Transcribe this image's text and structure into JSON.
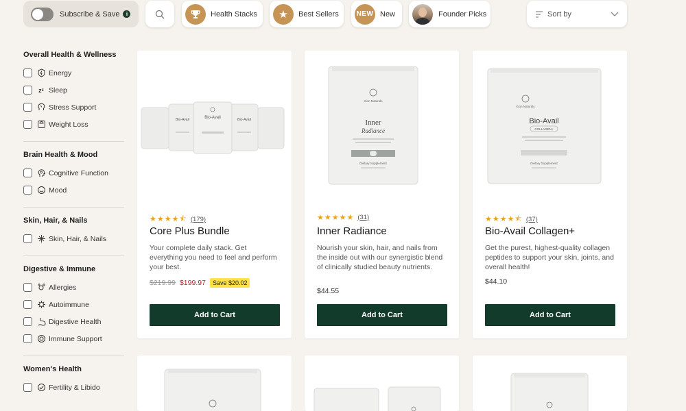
{
  "topbar": {
    "subscribe_label": "Subscribe & Save",
    "subscribe_info": "i",
    "chips": [
      {
        "label": "Health Stacks",
        "icon": "trophy-icon"
      },
      {
        "label": "Best Sellers",
        "icon": "star-icon"
      },
      {
        "label": "New",
        "icon": "new-badge-icon",
        "badge_text": "NEW"
      },
      {
        "label": "Founder Picks",
        "icon": "founder-avatar"
      }
    ],
    "sort_label": "Sort by"
  },
  "sidebar": {
    "groups": [
      {
        "title": "Overall Health & Wellness",
        "items": [
          "Energy",
          "Sleep",
          "Stress Support",
          "Weight Loss"
        ]
      },
      {
        "title": "Brain Health & Mood",
        "items": [
          "Cognitive Function",
          "Mood"
        ]
      },
      {
        "title": "Skin, Hair, & Nails",
        "items": [
          "Skin, Hair, & Nails"
        ]
      },
      {
        "title": "Digestive & Immune",
        "items": [
          "Allergies",
          "Autoimmune",
          "Digestive Health",
          "Immune Support"
        ]
      },
      {
        "title": "Women's Health",
        "items": [
          "Fertility & Libido"
        ]
      }
    ]
  },
  "products": [
    {
      "title": "Core Plus Bundle",
      "rating_count": "(179)",
      "stars": 4.5,
      "description": "Your complete daily stack. Get everything you need to feel and perform your best.",
      "old_price": "$219.99",
      "price": "$199.97",
      "save": "Save $20.02",
      "cta": "Add to Cart",
      "pouch_labels": [
        "Bio-Avail",
        "Bio-Avail",
        "Bio-Avail"
      ]
    },
    {
      "title": "Inner Radiance",
      "rating_count": "(31)",
      "stars": 5,
      "description": "Nourish your skin, hair, and nails from the inside out with our synergistic blend of clinically studied beauty nutrients.",
      "price": "$44.55",
      "cta": "Add to Cart",
      "pouch_brand": "Kion Naturals",
      "pouch_name": "Inner",
      "pouch_sub": "Radiance",
      "pouch_note": "Dietary Supplement"
    },
    {
      "title": "Bio-Avail Collagen+",
      "rating_count": "(37)",
      "stars": 4.5,
      "description": "Get the purest, highest-quality collagen peptides to support your skin, joints, and overall health!",
      "price": "$44.10",
      "cta": "Add to Cart",
      "pouch_brand": "Kion Naturals",
      "pouch_name": "Bio-Avail",
      "pouch_sub": "COLLAGEN+",
      "pouch_note": "Dietary Supplement"
    }
  ],
  "colors": {
    "background": "#f6f3ee",
    "accent_gold": "#c69556",
    "button_green": "#123b2c",
    "star": "#e8a21b",
    "sale_red": "#b3262d",
    "save_yellow": "#ffe14a"
  }
}
